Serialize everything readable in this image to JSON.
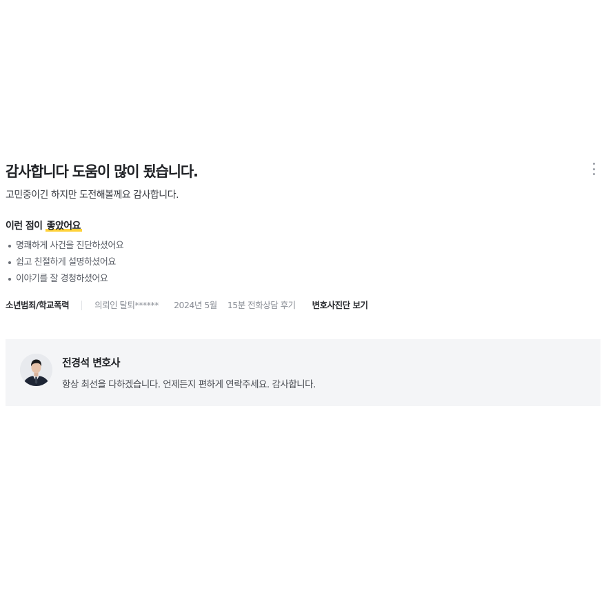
{
  "review": {
    "title": "감사합니다 도움이 많이 됬습니다.",
    "body": "고민중이긴 하지만 도전해볼께요 감사합니다.",
    "good_points_prefix": "이런 점이 ",
    "good_points_highlight": "좋았어요",
    "good_points": [
      "명쾌하게 사건을 진단하셨어요",
      "쉽고 친절하게 설명하셨어요",
      "이야기를 잘 경청하셨어요"
    ],
    "meta": {
      "category": "소년범죄/학교폭력",
      "client": "의뢰인 탈퇴******",
      "date": "2024년 5월",
      "consult_type": "15분 전화상담 후기",
      "diagnosis_link": "변호사진단 보기"
    },
    "more_icon": "more-vertical-icon"
  },
  "reply": {
    "lawyer_name": "전경석 변호사",
    "message": "항상 최선을 다하겠습니다. 언제든지 편하게 연락주세요. 감사합니다.",
    "avatar_icon": "lawyer-avatar"
  },
  "colors": {
    "highlight": "#ffd23a",
    "reply_background": "#f4f5f7",
    "meta_gray": "#8b8f97"
  }
}
